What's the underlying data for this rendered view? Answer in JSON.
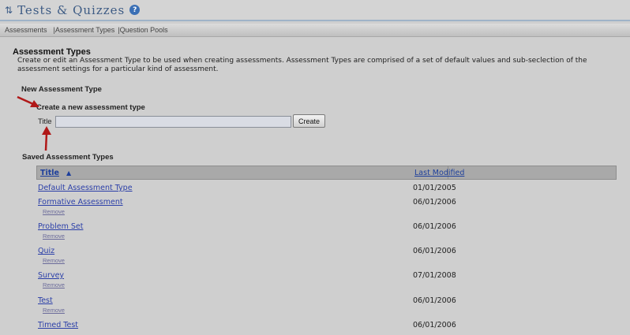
{
  "header": {
    "title": "Tests & Quizzes",
    "help_icon": "?"
  },
  "nav": {
    "assessments": "Assessments",
    "sep1": "|",
    "assessment_types": "Assessment Types",
    "sep2": "|",
    "question_pools": "Question Pools"
  },
  "section": {
    "title": "Assessment Types",
    "description": "Create or edit an Assessment Type to be used when creating assessments. Assessment Types are comprised of a set of default values and sub-seclection of the assessment settings for a particular kind of assessment."
  },
  "new_type": {
    "heading": "New Assessment Type",
    "create_label": "Create a new assessment type",
    "title_label": "Title",
    "title_value": "",
    "create_button": "Create"
  },
  "saved": {
    "heading": "Saved Assessment Types",
    "columns": {
      "title": "Title",
      "sort_indicator": "▲",
      "last_modified": "Last Modified"
    },
    "remove_label": "Remove",
    "rows": [
      {
        "name": "Default Assessment Type",
        "date": "01/01/2005",
        "removable": false
      },
      {
        "name": "Formative Assessment",
        "date": "06/01/2006",
        "removable": true
      },
      {
        "name": "Problem Set",
        "date": "06/01/2006",
        "removable": true
      },
      {
        "name": "Quiz",
        "date": "06/01/2006",
        "removable": true
      },
      {
        "name": "Survey",
        "date": "07/01/2008",
        "removable": true
      },
      {
        "name": "Test",
        "date": "06/01/2006",
        "removable": true
      },
      {
        "name": "Timed Test",
        "date": "06/01/2006",
        "removable": true
      }
    ]
  },
  "colors": {
    "link": "#2b3fa8",
    "arrow": "#b01818",
    "header_title": "#3d5b84"
  }
}
